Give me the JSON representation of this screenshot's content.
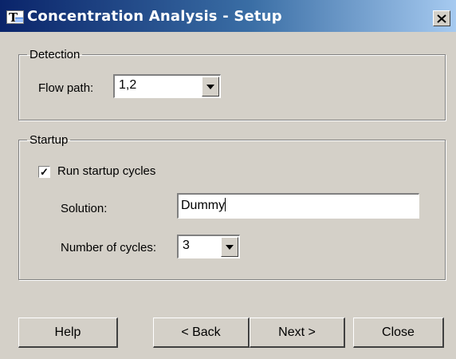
{
  "window": {
    "title": "Concentration Analysis - Setup",
    "close_glyph": "✕",
    "app_icon": "app-t-icon"
  },
  "detection": {
    "legend": "Detection",
    "flow_path_label": "Flow path:",
    "flow_path_value": "1,2"
  },
  "startup": {
    "legend": "Startup",
    "run_startup_label": "Run startup cycles",
    "run_startup_checked": true,
    "solution_label": "Solution:",
    "solution_value": "Dummy",
    "cycles_label": "Number of cycles:",
    "cycles_value": "3"
  },
  "buttons": {
    "help": "Help",
    "back": "< Back",
    "next": "Next >",
    "close": "Close"
  }
}
